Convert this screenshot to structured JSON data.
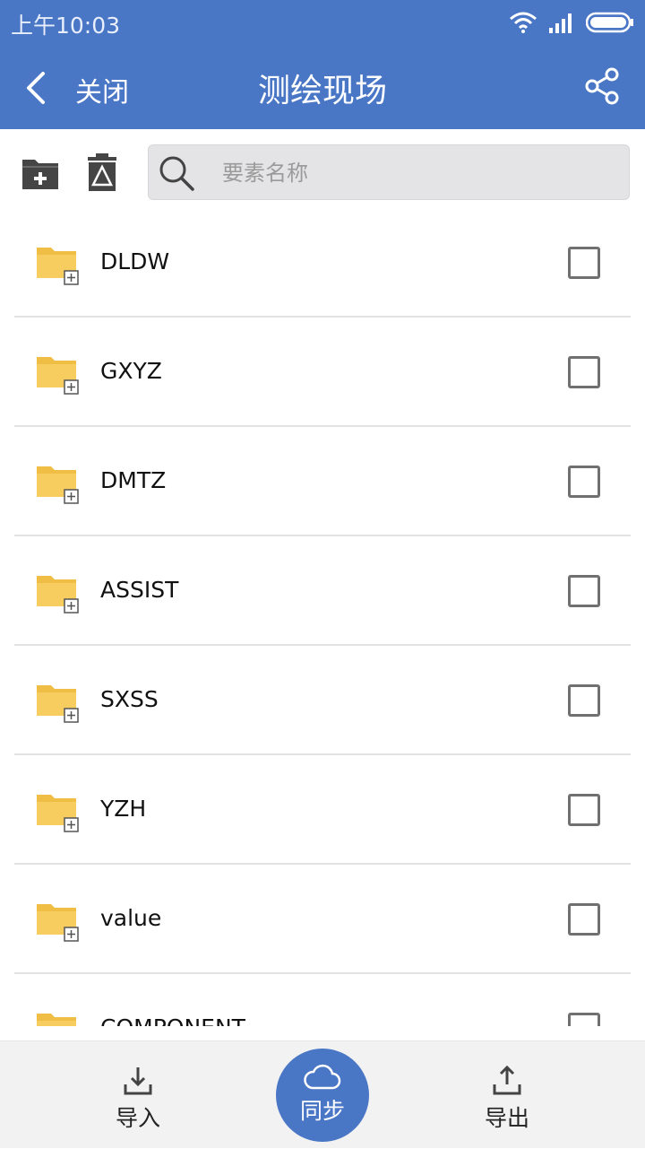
{
  "status_bar": {
    "time": "上午10:03"
  },
  "header": {
    "back_label": "关闭",
    "title": "测绘现场"
  },
  "toolbar": {
    "search_placeholder": "要素名称"
  },
  "list": {
    "items": [
      {
        "label": "DLDW"
      },
      {
        "label": "GXYZ"
      },
      {
        "label": "DMTZ"
      },
      {
        "label": "ASSIST"
      },
      {
        "label": "SXSS"
      },
      {
        "label": "YZH"
      },
      {
        "label": "value"
      },
      {
        "label": "COMPONENT"
      }
    ]
  },
  "bottom_bar": {
    "import_label": "导入",
    "sync_label": "同步",
    "export_label": "导出"
  },
  "colors": {
    "primary": "#4a76c6",
    "folder": "#f2c24e",
    "background": "#ffffff"
  }
}
